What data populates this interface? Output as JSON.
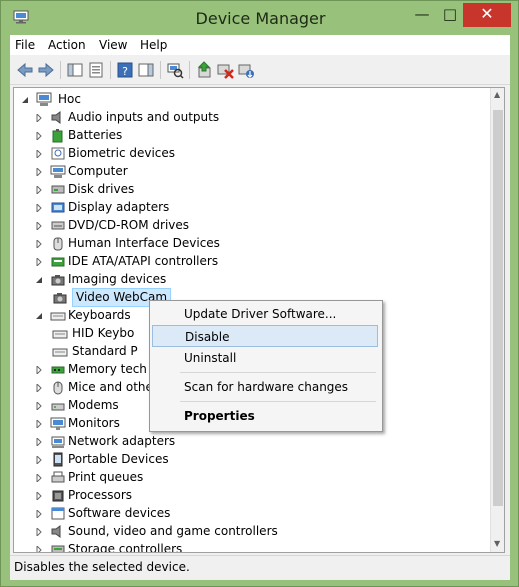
{
  "window": {
    "title": "Device Manager"
  },
  "menu": [
    "File",
    "Action",
    "View",
    "Help"
  ],
  "toolbar_icons": [
    "back-icon",
    "forward-icon",
    "show-hide-console-tree-icon",
    "properties-icon",
    "help-icon",
    "show-hide-action-pane-icon",
    "scan-hardware-icon",
    "update-driver-icon",
    "disable-device-icon",
    "uninstall-device-icon"
  ],
  "tree": {
    "root": "Hoc",
    "items": [
      {
        "label": "Audio inputs and outputs",
        "icon": "speaker-icon",
        "state": "collapsed"
      },
      {
        "label": "Batteries",
        "icon": "battery-icon",
        "state": "collapsed"
      },
      {
        "label": "Biometric devices",
        "icon": "biometric-icon",
        "state": "collapsed"
      },
      {
        "label": "Computer",
        "icon": "computer-icon",
        "state": "collapsed"
      },
      {
        "label": "Disk drives",
        "icon": "disk-drive-icon",
        "state": "collapsed"
      },
      {
        "label": "Display adapters",
        "icon": "display-adapter-icon",
        "state": "collapsed"
      },
      {
        "label": "DVD/CD-ROM drives",
        "icon": "dvd-drive-icon",
        "state": "collapsed"
      },
      {
        "label": "Human Interface Devices",
        "icon": "hid-icon",
        "state": "collapsed"
      },
      {
        "label": "IDE ATA/ATAPI controllers",
        "icon": "ide-controller-icon",
        "state": "collapsed"
      },
      {
        "label": "Imaging devices",
        "icon": "camera-icon",
        "state": "expanded"
      },
      {
        "label": "Video WebCam",
        "icon": "webcam-icon",
        "state": "child-selected"
      },
      {
        "label": "Keyboards",
        "icon": "keyboard-icon",
        "state": "expanded"
      },
      {
        "label": "HID Keybo",
        "icon": "keyboard-icon",
        "state": "child"
      },
      {
        "label": "Standard P",
        "icon": "keyboard-icon",
        "state": "child"
      },
      {
        "label": "Memory tech",
        "icon": "memory-icon",
        "state": "collapsed"
      },
      {
        "label": "Mice and othe",
        "icon": "mouse-icon",
        "state": "collapsed"
      },
      {
        "label": "Modems",
        "icon": "modem-icon",
        "state": "collapsed"
      },
      {
        "label": "Monitors",
        "icon": "monitor-icon",
        "state": "collapsed"
      },
      {
        "label": "Network adapters",
        "icon": "network-adapter-icon",
        "state": "collapsed"
      },
      {
        "label": "Portable Devices",
        "icon": "portable-device-icon",
        "state": "collapsed"
      },
      {
        "label": "Print queues",
        "icon": "printer-icon",
        "state": "collapsed"
      },
      {
        "label": "Processors",
        "icon": "processor-icon",
        "state": "collapsed"
      },
      {
        "label": "Software devices",
        "icon": "software-device-icon",
        "state": "collapsed"
      },
      {
        "label": "Sound, video and game controllers",
        "icon": "sound-controller-icon",
        "state": "collapsed"
      },
      {
        "label": "Storage controllers",
        "icon": "storage-controller-icon",
        "state": "collapsed"
      }
    ]
  },
  "context_menu": {
    "update_driver": "Update Driver Software...",
    "disable": "Disable",
    "uninstall": "Uninstall",
    "scan": "Scan for hardware changes",
    "properties": "Properties"
  },
  "status": "Disables the selected device.",
  "colors": {
    "frame": "#98c27c",
    "close": "#c7352b",
    "selection": "#cce8ff",
    "menu_highlight": "#dce9f7"
  }
}
